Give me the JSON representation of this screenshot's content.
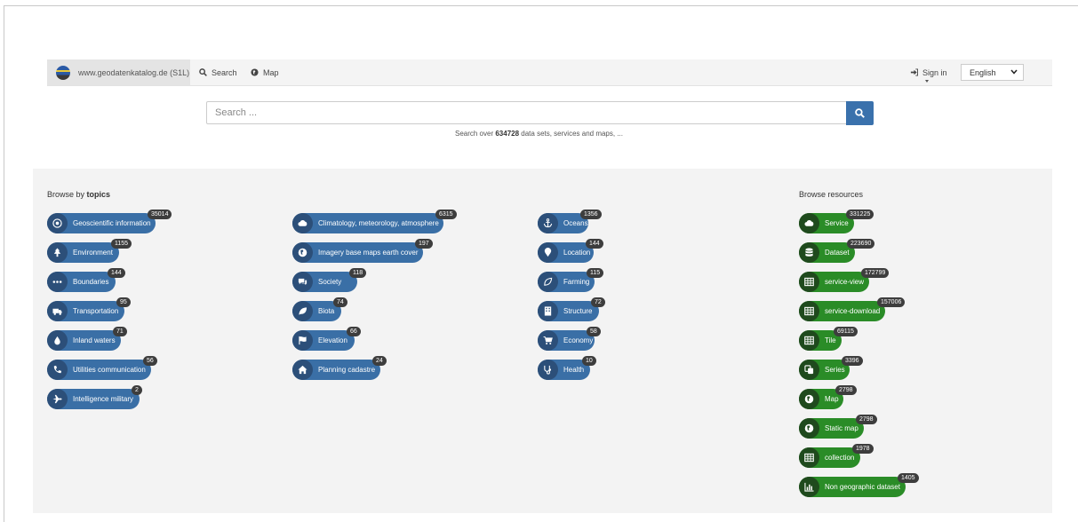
{
  "navbar": {
    "brand": "www.geodatenkatalog.de (S1L)",
    "search_label": "Search",
    "map_label": "Map",
    "signin_label": "Sign in",
    "language": "English"
  },
  "search": {
    "placeholder": "Search ...",
    "hint_prefix": "Search over ",
    "hint_count": "634728",
    "hint_suffix": " data sets, services and maps, ..."
  },
  "topics": {
    "heading_prefix": "Browse by ",
    "heading_bold": "topics",
    "items": [
      {
        "label": "Geoscientific information",
        "count": "35014",
        "icon": "target-icon"
      },
      {
        "label": "Environment",
        "count": "1155",
        "icon": "tree-icon"
      },
      {
        "label": "Boundaries",
        "count": "144",
        "icon": "dots-icon"
      },
      {
        "label": "Transportation",
        "count": "95",
        "icon": "truck-icon"
      },
      {
        "label": "Inland waters",
        "count": "71",
        "icon": "drop-icon"
      },
      {
        "label": "Utilities communication",
        "count": "56",
        "icon": "phone-icon"
      },
      {
        "label": "Intelligence military",
        "count": "2",
        "icon": "plane-icon"
      },
      {
        "label": "Climatology, meteorology, atmosphere",
        "count": "6315",
        "icon": "cloud-icon"
      },
      {
        "label": "Imagery base maps earth cover",
        "count": "197",
        "icon": "globe-icon"
      },
      {
        "label": "Society",
        "count": "118",
        "icon": "comments-icon"
      },
      {
        "label": "Biota",
        "count": "74",
        "icon": "leaf-icon"
      },
      {
        "label": "Elevation",
        "count": "66",
        "icon": "flag-icon"
      },
      {
        "label": "Planning cadastre",
        "count": "24",
        "icon": "home-icon"
      },
      {
        "label": "Oceans",
        "count": "1356",
        "icon": "anchor-icon"
      },
      {
        "label": "Location",
        "count": "144",
        "icon": "map-marker-icon"
      },
      {
        "label": "Farming",
        "count": "115",
        "icon": "farming-leaf-icon"
      },
      {
        "label": "Structure",
        "count": "72",
        "icon": "building-icon"
      },
      {
        "label": "Economy",
        "count": "58",
        "icon": "cart-icon"
      },
      {
        "label": "Health",
        "count": "10",
        "icon": "stethoscope-icon"
      }
    ]
  },
  "resources": {
    "heading": "Browse resources",
    "items": [
      {
        "label": "Service",
        "count": "331225",
        "icon": "cloud-icon"
      },
      {
        "label": "Dataset",
        "count": "223690",
        "icon": "database-icon"
      },
      {
        "label": "service-view",
        "count": "172799",
        "icon": "grid-icon"
      },
      {
        "label": "service-download",
        "count": "157006",
        "icon": "grid-icon"
      },
      {
        "label": "Tile",
        "count": "69115",
        "icon": "grid-icon"
      },
      {
        "label": "Series",
        "count": "3396",
        "icon": "copy-icon"
      },
      {
        "label": "Map",
        "count": "2798",
        "icon": "globe-icon"
      },
      {
        "label": "Static map",
        "count": "2798",
        "icon": "globe-icon"
      },
      {
        "label": "collection",
        "count": "1978",
        "icon": "grid-icon"
      },
      {
        "label": "Non geographic dataset",
        "count": "1405",
        "icon": "bar-chart-icon"
      }
    ]
  },
  "colors": {
    "topic_pill": "#3a6fa6",
    "resource_pill": "#2a8c27",
    "search_button": "#3a71ac"
  }
}
